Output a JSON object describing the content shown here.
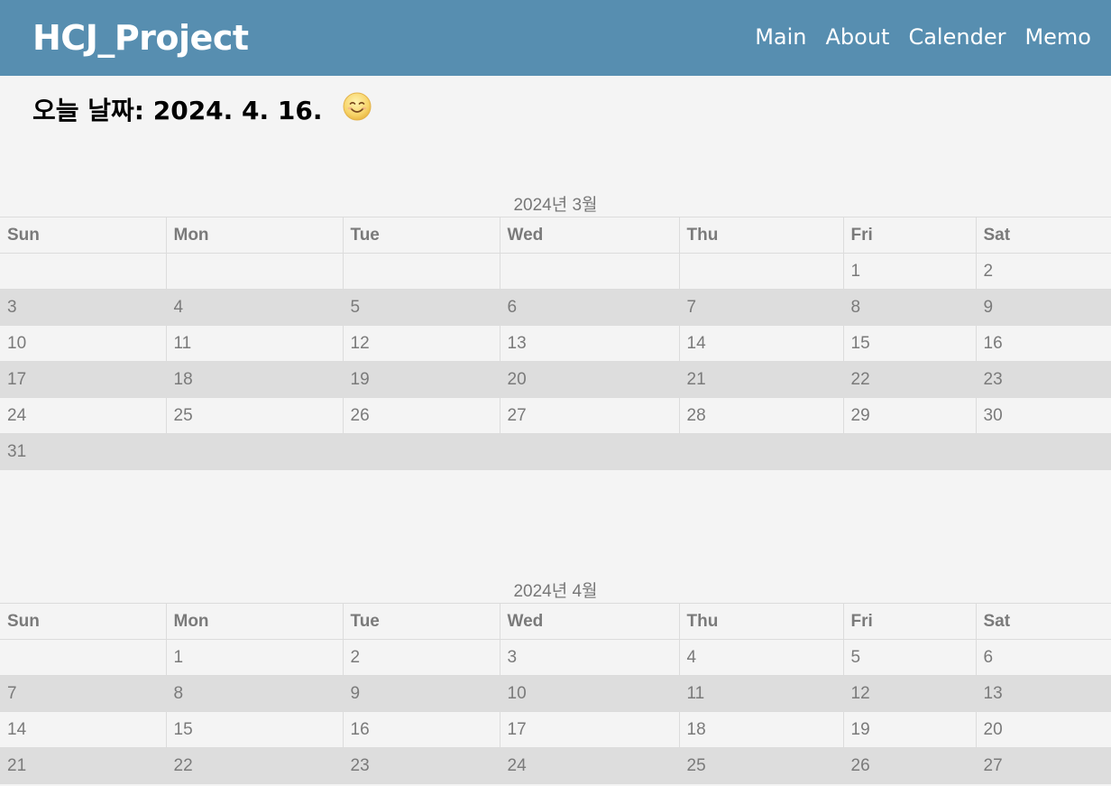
{
  "header": {
    "brand": "HCJ_Project",
    "nav": [
      "Main",
      "About",
      "Calender",
      "Memo"
    ]
  },
  "today": {
    "text": "오늘 날짜: 2024. 4. 16.",
    "emoji_icon": "smiling-face-icon"
  },
  "weekdays": [
    "Sun",
    "Mon",
    "Tue",
    "Wed",
    "Thu",
    "Fri",
    "Sat"
  ],
  "calendars": [
    {
      "caption": "2024년 3월",
      "weeks": [
        [
          "",
          "",
          "",
          "",
          "",
          "1",
          "2"
        ],
        [
          "3",
          "4",
          "5",
          "6",
          "7",
          "8",
          "9"
        ],
        [
          "10",
          "11",
          "12",
          "13",
          "14",
          "15",
          "16"
        ],
        [
          "17",
          "18",
          "19",
          "20",
          "21",
          "22",
          "23"
        ],
        [
          "24",
          "25",
          "26",
          "27",
          "28",
          "29",
          "30"
        ],
        [
          "31",
          "",
          "",
          "",
          "",
          "",
          ""
        ]
      ]
    },
    {
      "caption": "2024년 4월",
      "weeks": [
        [
          "",
          "1",
          "2",
          "3",
          "4",
          "5",
          "6"
        ],
        [
          "7",
          "8",
          "9",
          "10",
          "11",
          "12",
          "13"
        ],
        [
          "14",
          "15",
          "16",
          "17",
          "18",
          "19",
          "20"
        ],
        [
          "21",
          "22",
          "23",
          "24",
          "25",
          "26",
          "27"
        ]
      ]
    }
  ],
  "colors": {
    "header_bg": "#578eb0",
    "page_bg": "#f4f4f4",
    "shaded_row": "#dddddd",
    "cell_text": "#7a7a7a"
  }
}
